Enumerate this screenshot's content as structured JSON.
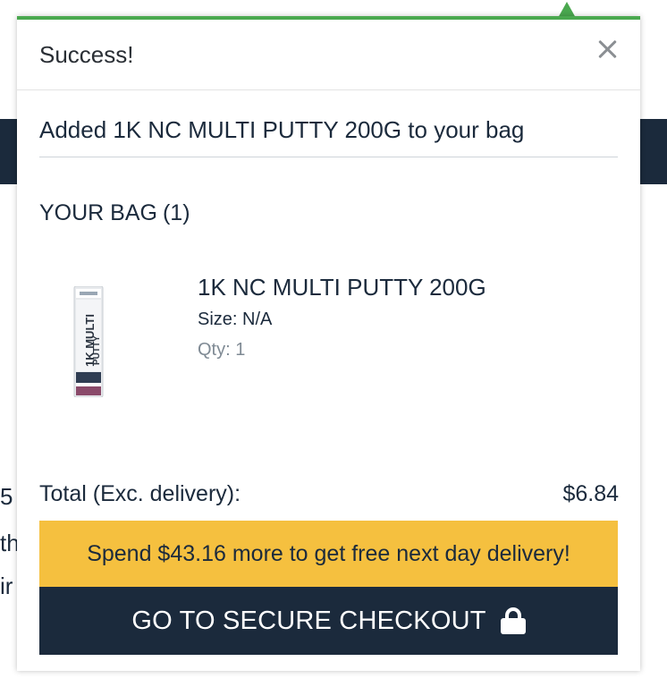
{
  "background": {
    "fragments": [
      "5",
      "th",
      "ir"
    ]
  },
  "popup": {
    "title": "Success!",
    "close_icon": "close-icon",
    "added_message": "Added 1K NC MULTI PUTTY 200G to your bag",
    "bag": {
      "label": "YOUR BAG",
      "count": "(1)"
    },
    "items": [
      {
        "name": "1K NC MULTI PUTTY 200G",
        "size": "Size: N/A",
        "qty": "Qty: 1",
        "image_label": "1K MULTI PUTTY"
      }
    ],
    "total": {
      "label": "Total (Exc. delivery):",
      "value": "$6.84"
    },
    "promo": "Spend $43.16 more to get free next day delivery!",
    "checkout": {
      "label": "GO TO SECURE CHECKOUT",
      "icon": "lock-icon"
    }
  },
  "colors": {
    "accent_green": "#4aa84f",
    "navy": "#1b2a3c",
    "promo_yellow": "#f5c03f"
  }
}
